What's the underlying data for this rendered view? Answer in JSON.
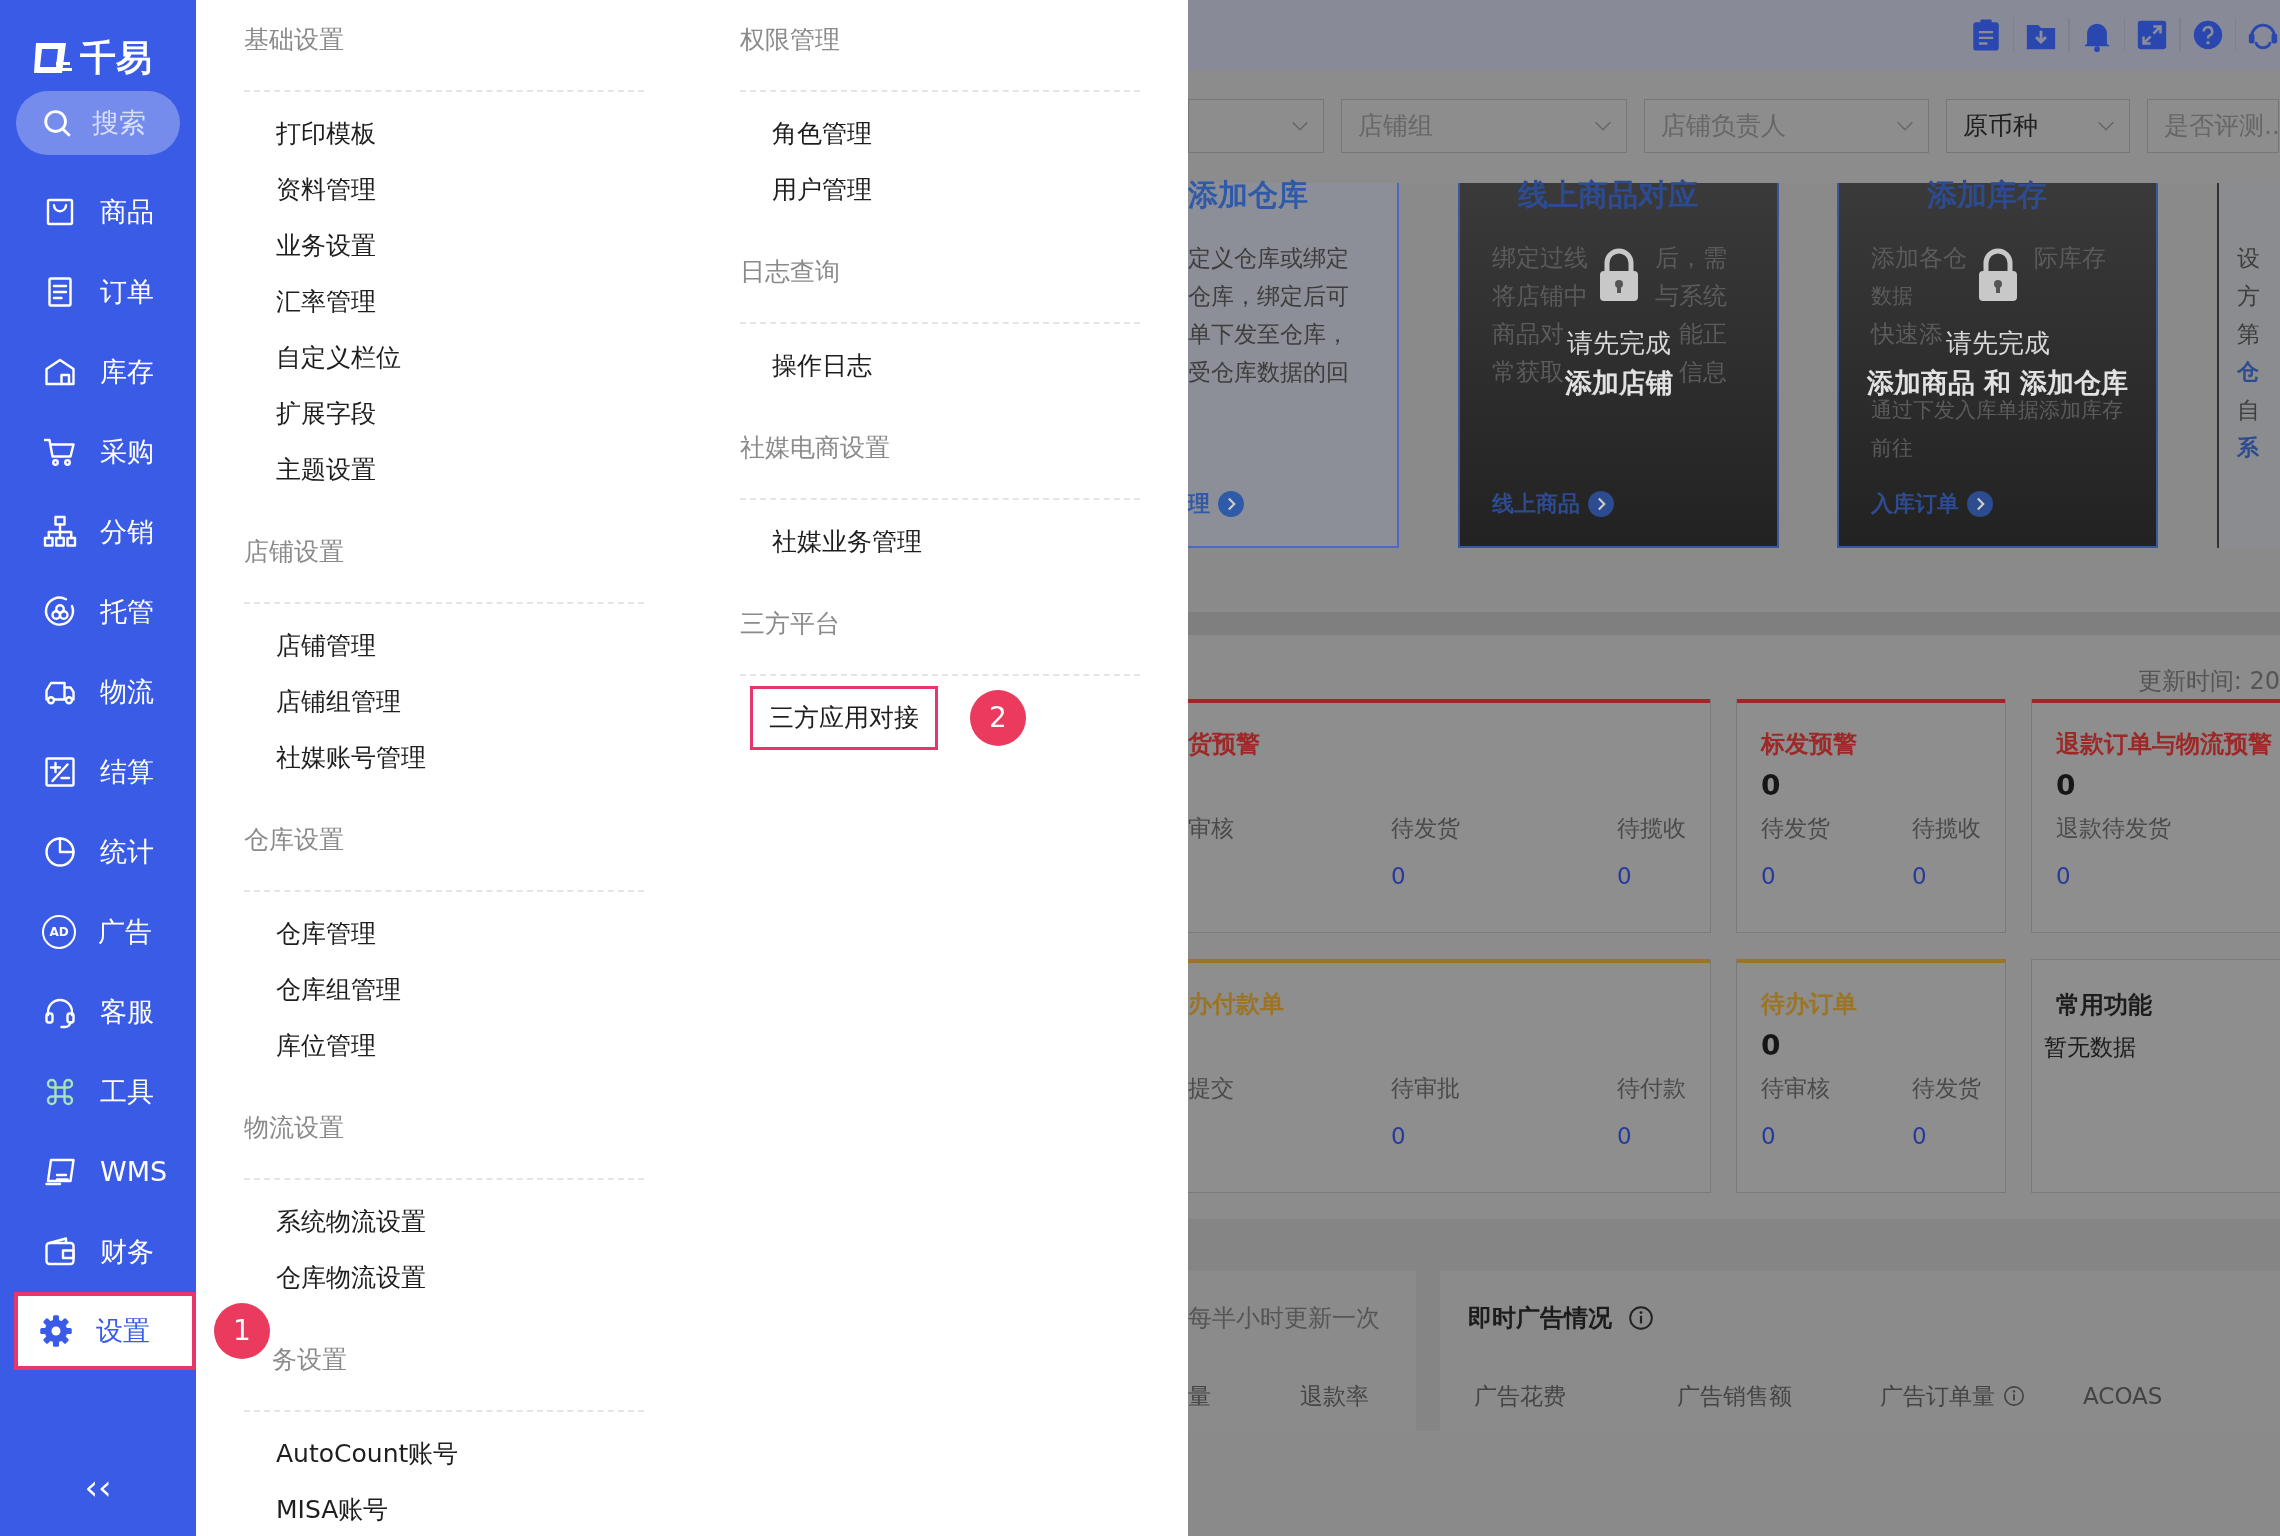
{
  "sidebar": {
    "logo": "千易",
    "search": "搜索",
    "items": [
      {
        "label": "商品",
        "selected": false,
        "highlighted": false
      },
      {
        "label": "订单",
        "selected": false,
        "highlighted": false
      },
      {
        "label": "库存",
        "selected": false,
        "highlighted": false
      },
      {
        "label": "采购",
        "selected": false,
        "highlighted": false
      },
      {
        "label": "分销",
        "selected": false,
        "highlighted": false
      },
      {
        "label": "托管",
        "selected": false,
        "highlighted": false
      },
      {
        "label": "物流",
        "selected": false,
        "highlighted": false
      },
      {
        "label": "结算",
        "selected": false,
        "highlighted": false
      },
      {
        "label": "统计",
        "selected": false,
        "highlighted": false
      },
      {
        "label": "广告",
        "selected": false,
        "highlighted": false,
        "icon_text": "AD"
      },
      {
        "label": "客服",
        "selected": false,
        "highlighted": false
      },
      {
        "label": "工具",
        "selected": false,
        "highlighted": false
      },
      {
        "label": "WMS",
        "selected": false,
        "highlighted": false
      },
      {
        "label": "财务",
        "selected": false,
        "highlighted": false
      },
      {
        "label": "设置",
        "selected": true,
        "highlighted": true,
        "marker": "1"
      }
    ],
    "collapse": "‹‹"
  },
  "settings_menu": {
    "columns": [
      {
        "groups": [
          {
            "title": "基础设置",
            "items": [
              {
                "label": "打印模板",
                "highlighted": false
              },
              {
                "label": "资料管理",
                "highlighted": false
              },
              {
                "label": "业务设置",
                "highlighted": false
              },
              {
                "label": "汇率管理",
                "highlighted": false
              },
              {
                "label": "自定义栏位",
                "highlighted": false
              },
              {
                "label": "扩展字段",
                "highlighted": false
              },
              {
                "label": "主题设置",
                "highlighted": false
              }
            ]
          },
          {
            "title": "店铺设置",
            "items": [
              {
                "label": "店铺管理",
                "highlighted": false
              },
              {
                "label": "店铺组管理",
                "highlighted": false
              },
              {
                "label": "社媒账号管理",
                "highlighted": false
              }
            ]
          },
          {
            "title": "仓库设置",
            "items": [
              {
                "label": "仓库管理",
                "highlighted": false
              },
              {
                "label": "仓库组管理",
                "highlighted": false
              },
              {
                "label": "库位管理",
                "highlighted": false
              }
            ]
          },
          {
            "title": "物流设置",
            "items": [
              {
                "label": "系统物流设置",
                "highlighted": false
              },
              {
                "label": "仓库物流设置",
                "highlighted": false
              }
            ]
          },
          {
            "title": "务设置",
            "items": [
              {
                "label": "AutoCount账号",
                "highlighted": false
              },
              {
                "label": "MISA账号",
                "highlighted": false
              }
            ]
          }
        ]
      },
      {
        "groups": [
          {
            "title": "权限管理",
            "items": [
              {
                "label": "角色管理",
                "highlighted": false
              },
              {
                "label": "用户管理",
                "highlighted": false
              }
            ]
          },
          {
            "title": "日志查询",
            "items": [
              {
                "label": "操作日志",
                "highlighted": false
              }
            ]
          },
          {
            "title": "社媒电商设置",
            "items": [
              {
                "label": "社媒业务管理",
                "highlighted": false
              }
            ]
          },
          {
            "title": "三方平台",
            "items": [
              {
                "label": "三方应用对接",
                "highlighted": true,
                "marker": "2"
              }
            ]
          }
        ]
      }
    ]
  },
  "background": {
    "filters": [
      {
        "kind": "select"
      },
      {
        "kind": "select",
        "placeholder": "店铺组"
      },
      {
        "kind": "select",
        "placeholder": "店铺负责人"
      },
      {
        "kind": "select",
        "value": "原币种"
      },
      {
        "kind": "select",
        "placeholder": "是否评测.."
      }
    ],
    "guide_cards": [
      {
        "kind": "open",
        "title": "添加仓库",
        "lines": [
          {
            "kind": "text",
            "text": "定义仓库或绑定"
          },
          {
            "kind": "text",
            "text": "仓库，绑定后可"
          },
          {
            "kind": "text",
            "text": "单下发至仓库，"
          },
          {
            "kind": "text",
            "text": "受仓库数据的回"
          },
          {
            "kind": "link",
            "text": "理"
          }
        ]
      },
      {
        "kind": "locked",
        "title": "线上商品对应",
        "lock_text": "请先完成",
        "lock_action": "添加店铺",
        "lines": [
          {
            "kind": "text",
            "parts": [
              "绑定过线",
              "后，需"
            ]
          },
          {
            "kind": "text",
            "parts": [
              "将店铺中",
              "与系统"
            ]
          },
          {
            "kind": "text",
            "parts": [
              "商品对",
              "能正"
            ]
          },
          {
            "kind": "text",
            "parts": [
              "常获取",
              "信息"
            ]
          },
          {
            "kind": "link",
            "text": "线上商品"
          }
        ]
      },
      {
        "kind": "locked",
        "title": "添加库存",
        "lock_text": "请先完成",
        "lock_action": "添加商品 和 添加仓库",
        "lines": [
          {
            "kind": "text",
            "parts": [
              "添加各仓",
              "际库存"
            ]
          },
          {
            "kind": "text",
            "text": "数据"
          },
          {
            "kind": "text",
            "parts": [
              "快速添"
            ]
          },
          {
            "kind": "covered"
          },
          {
            "kind": "text",
            "text": "通过下发入库单据添加库存"
          },
          {
            "kind": "text",
            "text": "前往"
          },
          {
            "kind": "link",
            "text": "入库订单"
          }
        ]
      },
      {
        "kind": "edge",
        "lines": [
          {
            "kind": "text",
            "text": "设"
          },
          {
            "kind": "text",
            "text": "方"
          },
          {
            "kind": "text",
            "text": "第"
          },
          {
            "kind": "link",
            "text": "仓"
          },
          {
            "kind": "text",
            "text": "自"
          },
          {
            "kind": "link",
            "text": "系"
          }
        ]
      }
    ],
    "update_time": "更新时间: 20",
    "alert_rows": [
      [
        {
          "color": "#9e2727",
          "title": "货预警",
          "stats": [
            {
              "label": "审核"
            },
            {
              "label": "待发货",
              "value": "0"
            },
            {
              "label": "待揽收",
              "value": "0"
            }
          ]
        },
        {
          "color": "#9e2727",
          "title": "标发预警",
          "count": "0",
          "stats": [
            {
              "label": "待发货",
              "value": "0"
            },
            {
              "label": "待揽收",
              "value": "0"
            }
          ]
        },
        {
          "color": "#9e2727",
          "title": "退款订单与物流预警",
          "count": "0",
          "stats": [
            {
              "label": "退款待发货",
              "value": "0"
            }
          ]
        }
      ],
      [
        {
          "color": "#9c7425",
          "title": "办付款单",
          "stats": [
            {
              "label": "提交"
            },
            {
              "label": "待审批",
              "value": "0"
            },
            {
              "label": "待付款",
              "value": "0"
            }
          ]
        },
        {
          "color": "#9c7425",
          "title": "待办订单",
          "count": "0",
          "stats": [
            {
              "label": "待审核",
              "value": "0"
            },
            {
              "label": "待发货",
              "value": "0"
            }
          ]
        },
        {
          "title": "常用功能",
          "empty": "暂无数据"
        }
      ]
    ],
    "refund_panel": {
      "note": "每半小时更新一次",
      "columns": [
        "量",
        "退款率"
      ]
    },
    "ads_panel": {
      "title": "即时广告情况",
      "columns": [
        {
          "label": "广告花费",
          "info": false
        },
        {
          "label": "广告销售额",
          "info": false
        },
        {
          "label": "广告订单量",
          "info": true
        },
        {
          "label": "ACOAS",
          "info": false
        }
      ]
    }
  }
}
